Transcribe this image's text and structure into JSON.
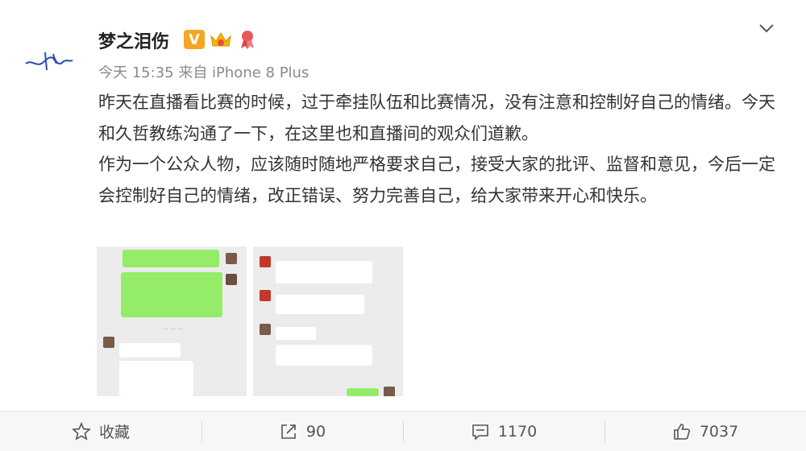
{
  "post": {
    "username": "梦之泪伤",
    "badge_v": "V",
    "meta": "今天 15:35 来自 iPhone 8 Plus",
    "paragraph1": "昨天在直播看比赛的时候，过于牵挂队伍和比赛情况，没有注意和控制好自己的情绪。今天和久哲教练沟通了一下，在这里也和直播间的观众们道歉。",
    "paragraph2": "作为一个公众人物，应该随时随地严格要求自己，接受大家的批评、监督和意见，今后一定会控制好自己的情绪，改正错误、努力完善自己，给大家带来开心和快乐。"
  },
  "icons": {
    "verified": "verified-v-icon",
    "crown": "crown-badge-icon",
    "ribbon": "ribbon-badge-icon",
    "dropdown": "chevron-down-icon",
    "favorite": "star-icon",
    "repost": "share-icon",
    "comment": "comment-icon",
    "like": "thumbs-up-icon"
  },
  "actions": {
    "favorite_label": "收藏",
    "repost_count": "90",
    "comment_count": "1170",
    "like_count": "7037"
  },
  "colors": {
    "verified": "#f5a623",
    "wechat_green": "#95ec69",
    "meta_gray": "#8a8a8a"
  }
}
